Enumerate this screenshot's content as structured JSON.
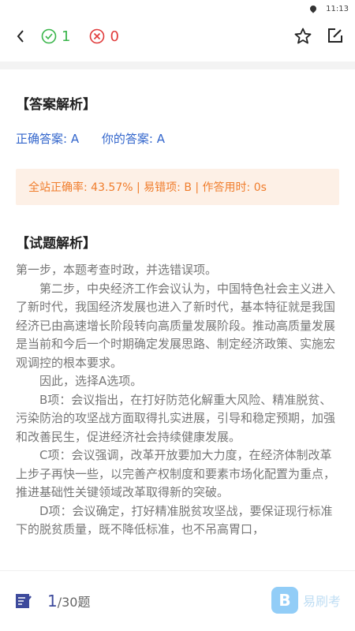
{
  "status": {
    "time": "11:13"
  },
  "header": {
    "correct_count": "1",
    "wrong_count": "0"
  },
  "answer_section": {
    "title": "【答案解析】",
    "correct_answer": "正确答案: A",
    "your_answer": "你的答案: A",
    "stats": "全站正确率: 43.57% | 易错项: B | 作答用时: 0s"
  },
  "analysis_section": {
    "title": "【试题解析】",
    "paragraphs": [
      "第一步，本题考查时政，并选错误项。",
      "第二步，中央经济工作会议认为，中国特色社会主义进入了新时代，我国经济发展也进入了新时代，基本特征就是我国经济已由高速增长阶段转向高质量发展阶段。推动高质量发展是当前和今后一个时期确定发展思路、制定经济政策、实施宏观调控的根本要求。",
      "因此，选择A选项。",
      "B项：会议指出，在打好防范化解重大风险、精准脱贫、污染防治的攻坚战方面取得扎实进展，引导和稳定预期，加强和改善民生，促进经济社会持续健康发展。",
      "C项：会议强调，改革开放要加大力度，在经济体制改革上步子再快一些，以完善产权制度和要素市场化配置为重点，推进基础性关键领域改革取得新的突破。",
      "D项：会议确定，打好精准脱贫攻坚战，要保证现行标准下的脱贫质量，既不降低标准，也不吊高胃口，"
    ]
  },
  "footer": {
    "current": "1",
    "total": "/30题",
    "brand_initial": "B",
    "brand_name": "易刷考"
  }
}
